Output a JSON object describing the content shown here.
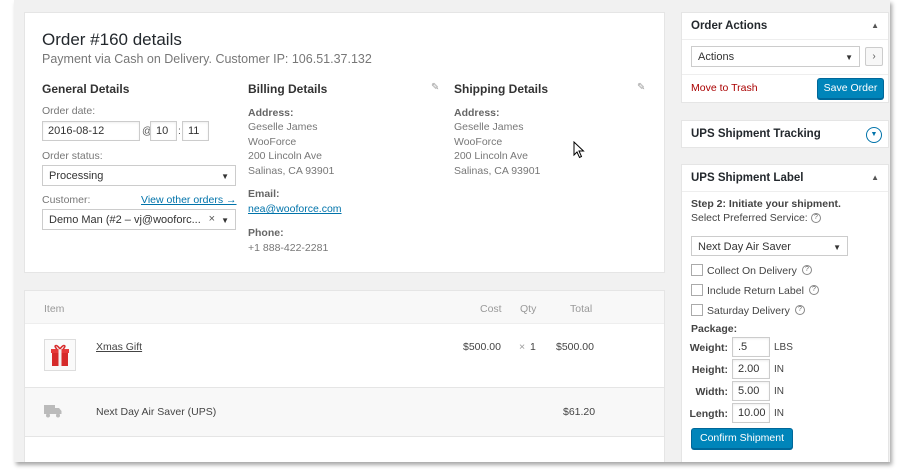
{
  "order": {
    "title": "Order #160 details",
    "subtitle": "Payment via Cash on Delivery. Customer IP: 106.51.37.132"
  },
  "general": {
    "heading": "General Details",
    "date_label": "Order date:",
    "date_value": "2016-08-12",
    "at": "@",
    "hour": "10",
    "colon": ":",
    "minute": "11",
    "status_label": "Order status:",
    "status_value": "Processing",
    "customer_label": "Customer:",
    "view_orders_link": "View other orders →",
    "customer_value": "Demo Man (#2 – vj@wooforc...",
    "clear": "×"
  },
  "billing": {
    "heading": "Billing Details",
    "address_label": "Address:",
    "address_lines": [
      "Geselle James",
      "WooForce",
      "200 Lincoln Ave",
      "Salinas, CA 93901"
    ],
    "email_label": "Email:",
    "email_value": "nea@wooforce.com",
    "phone_label": "Phone:",
    "phone_value": "+1 888-422-2281"
  },
  "shipping": {
    "heading": "Shipping Details",
    "address_label": "Address:",
    "address_lines": [
      "Geselle James",
      "WooForce",
      "200 Lincoln Ave",
      "Salinas, CA 93901"
    ]
  },
  "items": {
    "headers": {
      "item": "Item",
      "cost": "Cost",
      "qty": "Qty",
      "total": "Total"
    },
    "product": {
      "name": "Xmas Gift",
      "cost": "$500.00",
      "qty_symbol": "×",
      "qty": "1",
      "total": "$500.00"
    },
    "shipping_line": {
      "name": "Next Day Air Saver (UPS)",
      "total": "$61.20"
    }
  },
  "order_actions": {
    "title": "Order Actions",
    "select_value": "Actions",
    "go": "›",
    "trash": "Move to Trash",
    "save": "Save Order"
  },
  "ups_tracking": {
    "title": "UPS Shipment Tracking"
  },
  "ups_label": {
    "title": "UPS Shipment Label",
    "step": "Step 2: Initiate your shipment.",
    "service_label": "Select Preferred Service:",
    "service_value": "Next Day Air Saver",
    "options": [
      "Collect On Delivery",
      "Include Return Label",
      "Saturday Delivery"
    ],
    "package_label": "Package:",
    "fields": [
      {
        "label": "Weight:",
        "value": ".5",
        "unit": "LBS"
      },
      {
        "label": "Height:",
        "value": "2.00",
        "unit": "IN"
      },
      {
        "label": "Width:",
        "value": "5.00",
        "unit": "IN"
      },
      {
        "label": "Length:",
        "value": "10.00",
        "unit": "IN"
      }
    ],
    "confirm": "Confirm Shipment",
    "help": "?"
  },
  "colors": {
    "primary": "#0085ba",
    "link": "#0073aa",
    "trash": "#a00"
  }
}
